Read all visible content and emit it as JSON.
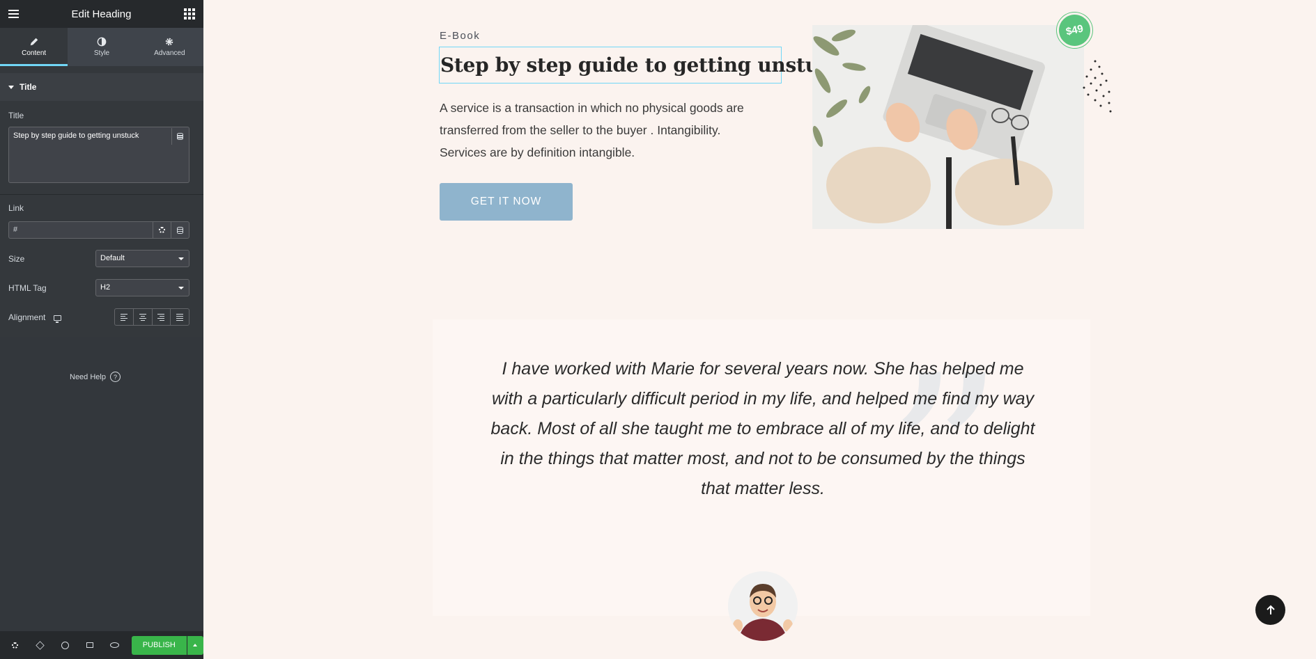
{
  "panel": {
    "header_title": "Edit Heading",
    "tabs": [
      {
        "label": "Content",
        "icon": "pencil-icon",
        "active": true
      },
      {
        "label": "Style",
        "icon": "half-circle-icon",
        "active": false
      },
      {
        "label": "Advanced",
        "icon": "gear-icon",
        "active": false
      }
    ],
    "section_title": "Title",
    "title_control": {
      "label": "Title",
      "value": "Step by step guide to getting unstuck"
    },
    "link_control": {
      "label": "Link",
      "value": "#"
    },
    "size_control": {
      "label": "Size",
      "value": "Default"
    },
    "html_tag_control": {
      "label": "HTML Tag",
      "value": "H2"
    },
    "alignment_control": {
      "label": "Alignment"
    },
    "need_help": "Need Help",
    "help_glyph": "?",
    "publish_label": "PUBLISH",
    "accent_color": "#71d7f7",
    "publish_color": "#39b54a"
  },
  "preview": {
    "eyebrow": "E-Book",
    "heading": "Step by step guide to getting unstuck",
    "description": "A service is a transaction in which no physical goods are transferred from the seller to the buyer . Intangibility. Services are by definition intangible.",
    "cta_label": "GET IT NOW",
    "price_badge": "$49",
    "testimonial": "I have worked with Marie for several years now. She has helped me with a particularly difficult period in my life, and helped me find my way back. Most of all she taught me to embrace all of my life, and to delight in the things that matter most, and not to be consumed by the things that matter less.",
    "quote_glyph": "”",
    "cta_color": "#8fb4cd",
    "badge_color": "#5ac57d"
  }
}
